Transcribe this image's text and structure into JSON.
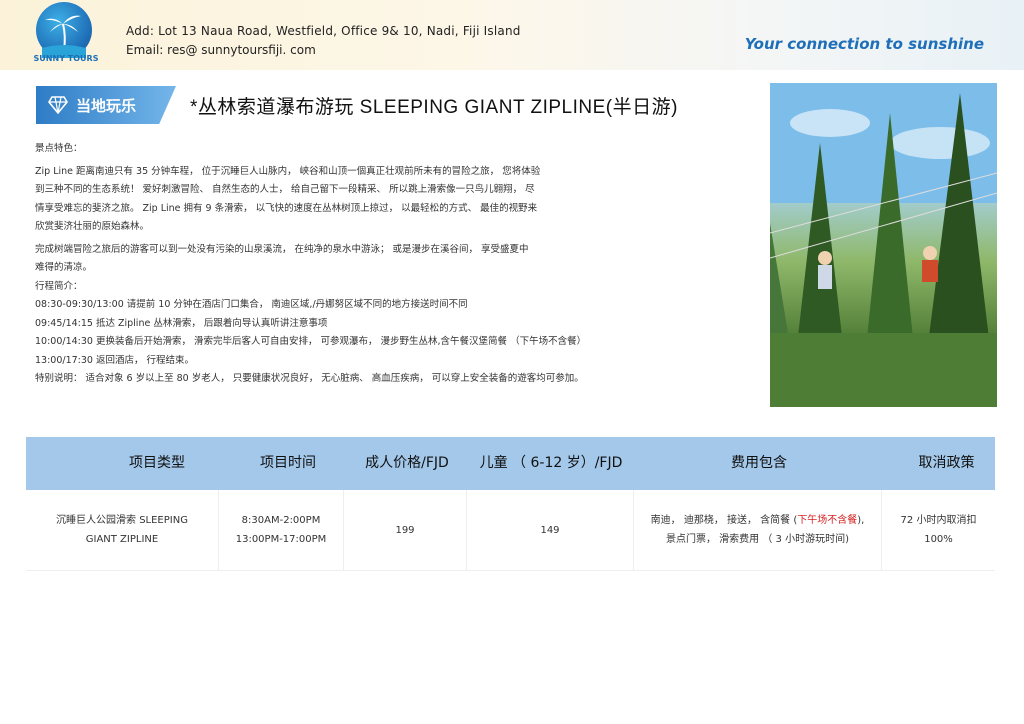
{
  "header": {
    "logo_text": "SUNNY TOURS",
    "address": "Add:  Lot 13  Naua  Road,  Westfield,  Office 9& 10,  Nadi,  Fiji Island",
    "email": "Email:   res@ sunnytoursfiji. com",
    "slogan": "Your  connection  to  sunshine"
  },
  "section": {
    "badge": "当地玩乐",
    "title": "*丛林索道瀑布游玩   SLEEPING  GIANT  ZIPLINE(半日游)"
  },
  "content": {
    "features_heading": "景点特色：",
    "para1": [
      "Zip Line 距离南迪只有 35 分钟车程，  位于沉睡巨人山脉内，  峡谷和山顶一個真正壮观前所未有的冒险之旅，  您将体验",
      "到三种不同的生态系统！  爱好刺激冒险、  自然生态的人士，  给自己留下一段精采、  所以跳上滑索像一只鸟儿翱翔，  尽",
      "情享受难忘的斐济之旅。  Zip Line 拥有 9 条滑索，  以飞快的速度在丛林树顶上掠过，  以最轻松的方式、  最佳的视野来",
      "欣赏斐济壮丽的原始森林。"
    ],
    "para2": [
      "完成树端冒险之旅后的游客可以到一处没有污染的山泉溪流，  在纯净的泉水中游泳；  或是漫步在溪谷间，  享受盛夏中",
      "难得的清凉。"
    ],
    "itinerary_heading": "行程简介：",
    "itinerary": [
      "08:30-09:30/13:00   请提前 10 分钟在酒店门口集合，  南迪区域,/丹娜努区域不同的地方接送时间不同",
      "09:45/14:15     抵达 Zipline  丛林滑索，  后跟着向导认真听讲注意事项",
      "10:00/14:30     更换装备后开始滑索，  滑索完毕后客人可自由安排，  可参观瀑布，  漫步野生丛林,含午餐汉堡简餐  （下午场不含餐）",
      "13:00/17:30     返回酒店，  行程结束。"
    ],
    "note": "特别说明：  适合对象 6 岁以上至 80 岁老人，  只要健康状况良好，  无心脏病、  高血压疾病，  可以穿上安全装备的遊客均可参加。"
  },
  "table": {
    "headers": [
      "项目类型",
      "项目时间",
      "成人价格/FJD",
      "儿童  （ 6-12 岁）/FJD",
      "费用包含",
      "取消政策"
    ],
    "row": {
      "type_line1": "沉睡巨人公园滑索   SLEEPING",
      "type_line2": "GIANT   ZIPLINE",
      "time_line1": "8:30AM-2:00PM",
      "time_line2": "13:00PM-17:00PM",
      "adult": "199",
      "child": "149",
      "incl_line1_a": "南迪，  迪那桡，  接送，  含简餐 (",
      "incl_line1_red": "下午场不含餐",
      "incl_line1_b": "),",
      "incl_line2": "景点门票，  滑索费用  （ 3 小时游玩时间)",
      "cancel_line1": "72  小时内取消扣",
      "cancel_line2": "100%"
    }
  },
  "colors": {
    "header_blue": "#a3c8ea",
    "slogan_blue": "#1f6fb8",
    "badge_blue": "#2e7cc6",
    "red_note": "#d62222"
  }
}
